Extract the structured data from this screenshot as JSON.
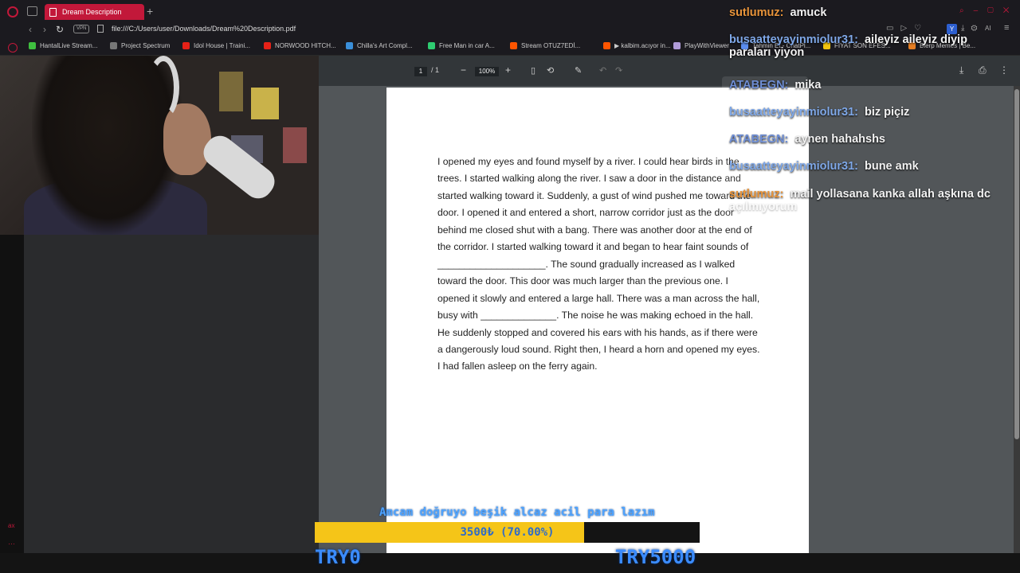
{
  "browser": {
    "tab_title": "Dream Description",
    "url": "file:///C:/Users/user/Downloads/Dream%20Description.pdf",
    "vpn_label": "VPN",
    "bookmarks": [
      {
        "label": "HantalLive Stream...",
        "color": "#3fbf3f"
      },
      {
        "label": "Project Spectrum",
        "color": "#777777"
      },
      {
        "label": "Idol House | Traini...",
        "color": "#e62117"
      },
      {
        "label": "NORWOOD HITCH...",
        "color": "#e62117"
      },
      {
        "label": "Chilla's Art Compl...",
        "color": "#3a8fd9"
      },
      {
        "label": "Free Man in car A...",
        "color": "#2ecc71"
      },
      {
        "label": "Stream OTUZ7EDİ...",
        "color": "#ff5500"
      },
      {
        "label": "▶ kalbim.acıyor in...",
        "color": "#ff5500"
      },
      {
        "label": "PlayWithViewer",
        "color": "#b19cd9"
      },
      {
        "label": "Tahmin Et - ChatPl...",
        "color": "#5b8def"
      },
      {
        "label": "FİYAT SON EFES...",
        "color": "#f1c40f"
      },
      {
        "label": "Blerp Memes | Be...",
        "color": "#e67e22"
      }
    ]
  },
  "pdf": {
    "page_current": "1",
    "page_total": "/ 1",
    "zoom": "100%",
    "text": "I opened my eyes and found myself by a river. I could hear birds in the trees. I started walking along the river. I saw a door in the distance and started walking toward it. Suddenly, a gust of wind pushed me toward the door. I opened it and entered a short, narrow corridor just as the door behind me closed shut with a bang. There was another door at the end of the corridor. I started walking toward it and began to hear faint sounds of ____________________. The sound gradually increased as I walked toward the door. This door was much larger than the previous one. I opened it slowly and entered a large hall. There was a man across the hall, busy with ______________. The noise he was making echoed in the hall. He suddenly stopped and covered his ears with his hands, as if there were a dangerously loud sound. Right then, I heard a horn and opened my eyes. I had fallen asleep on the ferry again."
  },
  "chat": [
    {
      "user": "sutlumuz:",
      "msg": "amuck",
      "color": "#e8943a"
    },
    {
      "user": "busaatteyayinmiolur31:",
      "msg": "aileyiz aileyiz diyip",
      "msg2": "paraları yiyon",
      "color": "#7fa8e8"
    },
    {
      "user": "ATABEGN:",
      "msg": "mika",
      "color": "#6f8fd6"
    },
    {
      "user": "busaatteyayinmiolur31:",
      "msg": "biz piçiz",
      "color": "#7fa8e8"
    },
    {
      "user": "ATABEGN:",
      "msg": "aynen hahahshs",
      "color": "#6f8fd6"
    },
    {
      "user": "busaatteyayinmiolur31:",
      "msg": "bune amk",
      "color": "#7fa8e8"
    },
    {
      "user": "sutlumuz:",
      "msg": "mail yollasana kanka allah aşkına dc",
      "msg2": "açılmıyorum",
      "color": "#e8943a"
    }
  ],
  "goal": {
    "title": "Amcam doğruyo beşik alcaz acil para lazım",
    "progress_label": "3500₺ (70.00%)",
    "progress_fraction": 0.7,
    "min_label": "TRY0",
    "max_label": "TRY5000",
    "fill_color": "#f5c518"
  }
}
